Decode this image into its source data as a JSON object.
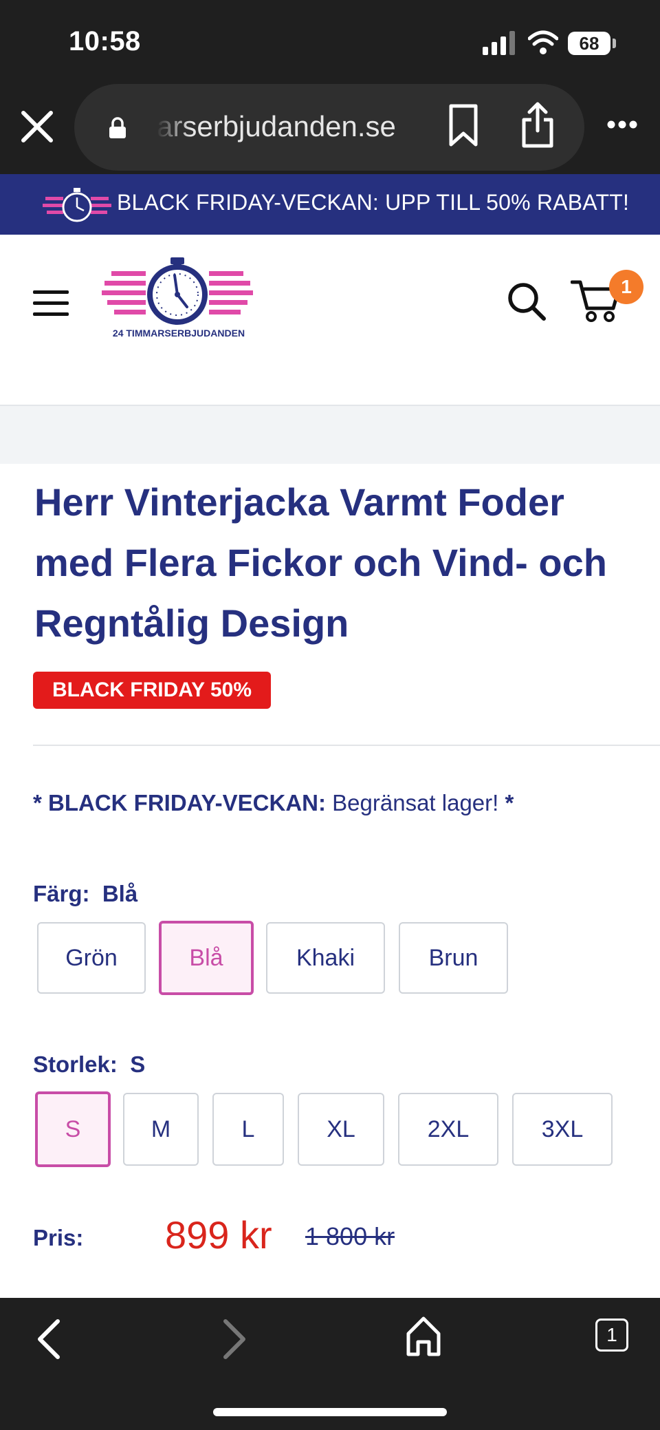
{
  "status_bar": {
    "time": "10:58",
    "battery": "68"
  },
  "browser": {
    "url": "arserbjudanden.se",
    "tabs_count": "1"
  },
  "promo": {
    "text": "BLACK FRIDAY-VECKAN: UPP TILL 50% RABATT!"
  },
  "header": {
    "logo_text": "24 TIMMARSERBJUDANDEN",
    "cart_count": "1"
  },
  "product": {
    "title": "Herr Vinterjacka Varmt Foder med Flera Fickor och Vind- och Regntålig Design",
    "badge": "BLACK FRIDAY 50%",
    "notice_bold": "* BLACK FRIDAY-VECKAN:",
    "notice_text": " Begränsat lager! ",
    "notice_end": "*",
    "color_label": "Färg:",
    "color_selected": "Blå",
    "colors": [
      "Grön",
      "Blå",
      "Khaki",
      "Brun"
    ],
    "size_label": "Storlek:",
    "size_selected": "S",
    "sizes": [
      "S",
      "M",
      "L",
      "XL",
      "2XL",
      "3XL"
    ],
    "price_label": "Pris:",
    "price_now": "899 kr",
    "price_old": "1 800 kr"
  },
  "colors": {
    "brand_blue": "#26307f",
    "accent_pink": "#c84da7",
    "sale_red": "#e31b1b",
    "badge_orange": "#f47b2a"
  }
}
